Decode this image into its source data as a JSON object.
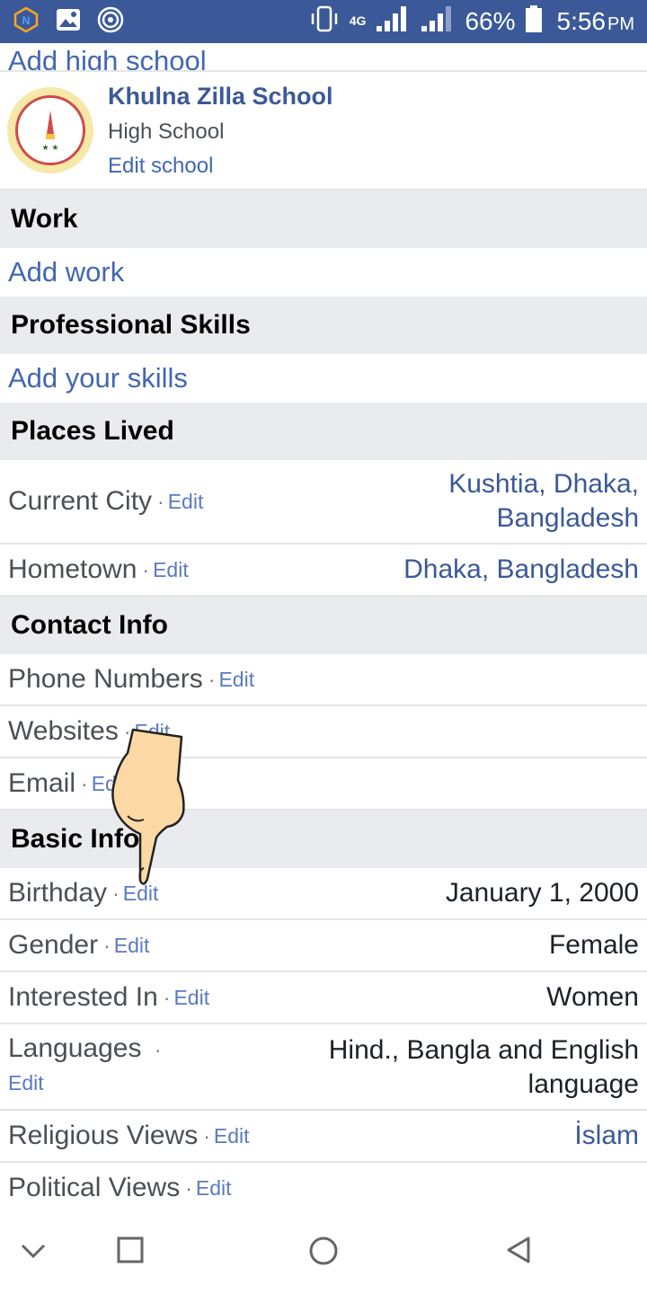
{
  "status_bar": {
    "network": "4G",
    "battery": "66%",
    "time": "5:56",
    "ampm": "PM"
  },
  "education": {
    "add_high_school": "Add high school",
    "school_name": "Khulna Zilla School",
    "school_type": "High School",
    "edit_school": "Edit school"
  },
  "work": {
    "header": "Work",
    "add": "Add work"
  },
  "skills": {
    "header": "Professional Skills",
    "add": "Add your skills"
  },
  "places": {
    "header": "Places Lived",
    "current_city_label": "Current City",
    "current_city_value_1": "Kushtia, Dhaka,",
    "current_city_value_2": "Bangladesh",
    "hometown_label": "Hometown",
    "hometown_value": "Dhaka, Bangladesh"
  },
  "contact": {
    "header": "Contact Info",
    "phone_label": "Phone Numbers",
    "websites_label": "Websites",
    "email_label": "Email"
  },
  "basic": {
    "header": "Basic Info",
    "birthday_label": "Birthday",
    "birthday_value": "January 1, 2000",
    "gender_label": "Gender",
    "gender_value": "Female",
    "interested_label": "Interested In",
    "interested_value": "Women",
    "languages_label": "Languages",
    "languages_value_1": "Hind., Bangla and English",
    "languages_value_2": "language",
    "religious_label": "Religious Views",
    "religious_value": "İslam",
    "political_label": "Political Views"
  },
  "common": {
    "edit": "Edit",
    "dot": "·"
  },
  "colors": {
    "brand": "#3b5998",
    "link": "#4267b2",
    "section_bg": "#e9ebee"
  }
}
